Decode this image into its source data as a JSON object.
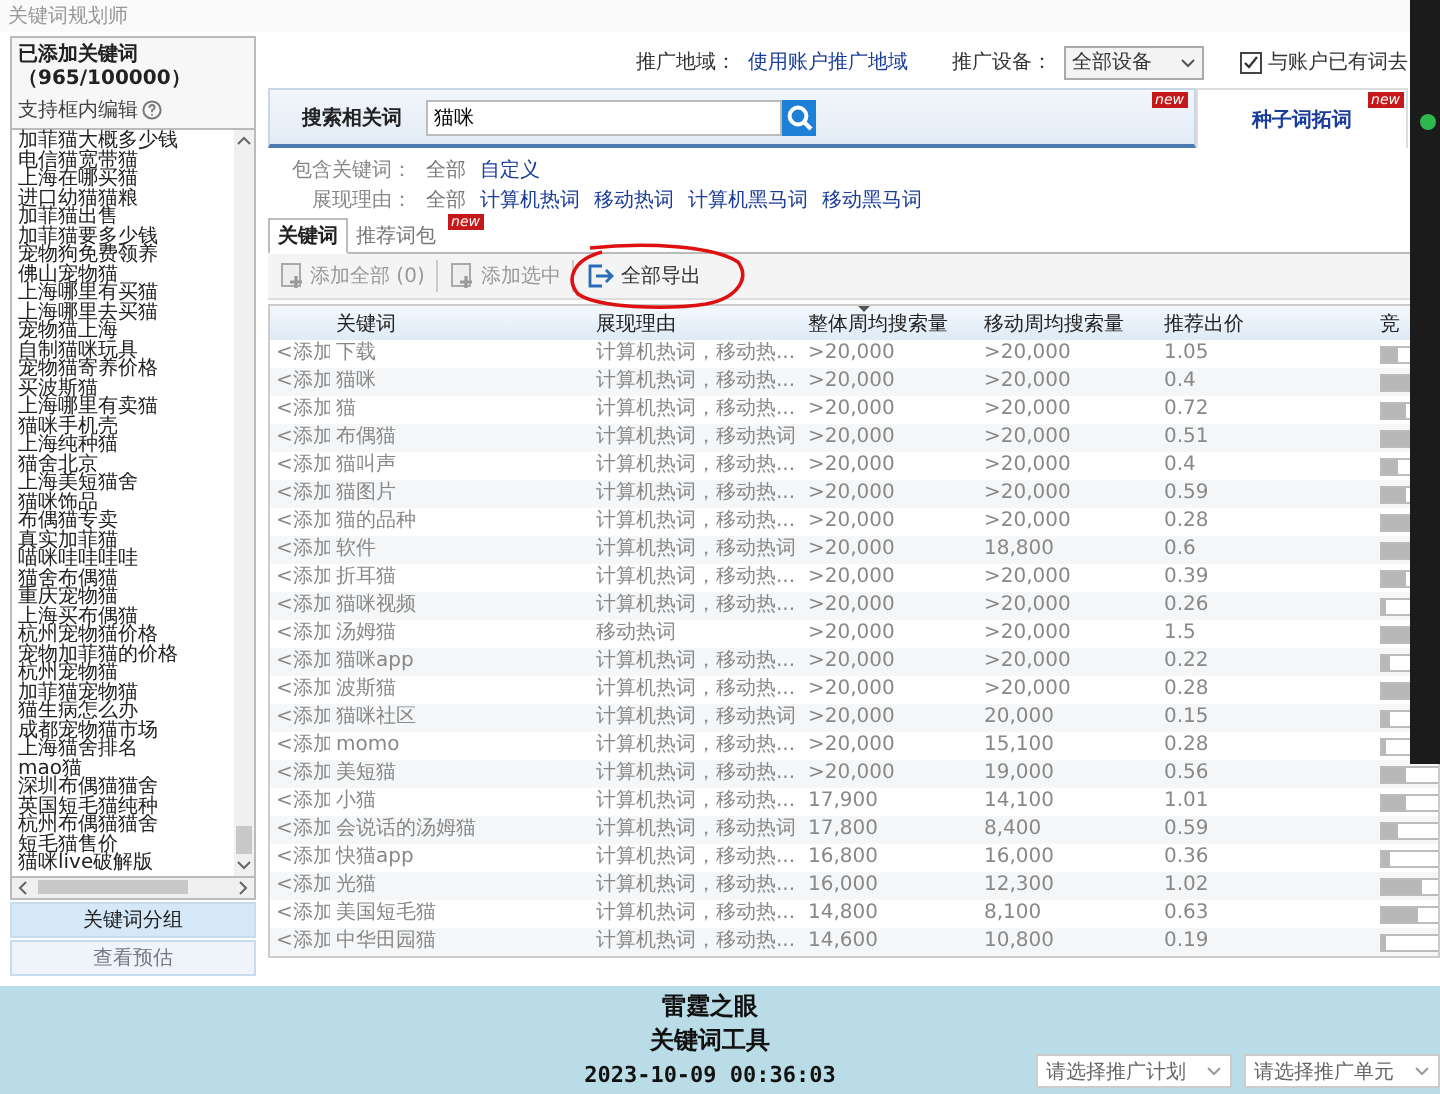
{
  "window": {
    "title": "关键词规划师"
  },
  "added_keywords": {
    "title": "已添加关键词（965/100000）",
    "hint": "支持框内编辑",
    "items": [
      "加菲猫大概多少钱",
      "电信猫宽带猫",
      "上海在哪买猫",
      "进口幼猫猫粮",
      "加菲猫出售",
      "加菲猫要多少钱",
      "宠物狗免费领养",
      "佛山宠物猫",
      "上海哪里有买猫",
      "上海哪里去买猫",
      "宠物猫上海",
      "自制猫咪玩具",
      "宠物猫寄养价格",
      "买波斯猫",
      "上海哪里有卖猫",
      "猫咪手机壳",
      "上海纯种猫",
      "猫舍北京",
      "上海美短猫舍",
      "猫咪饰品",
      "布偶猫专卖",
      "真实加菲猫",
      "喵咪哇哇哇哇",
      "猫舍布偶猫",
      "重庆宠物猫",
      "上海买布偶猫",
      "杭州宠物猫价格",
      "宠物加菲猫的价格",
      "杭州宠物猫",
      "加菲猫宠物猫",
      "猫生病怎么办",
      "成都宠物猫市场",
      "上海猫舍排名",
      "mao猫",
      "深圳布偶猫猫舍",
      "英国短毛猫纯种",
      "杭州布偶猫猫舍",
      "短毛猫售价",
      "猫咪live破解版"
    ]
  },
  "left_buttons": [
    {
      "label": "关键词分组",
      "disabled": false
    },
    {
      "label": "查看预估",
      "disabled": true
    }
  ],
  "settings": {
    "region_label": "推广地域：",
    "region_link": "使用账户推广地域",
    "device_label": "推广设备：",
    "device_value": "全部设备",
    "dedupe": {
      "label": "与账户已有词去",
      "checked": true
    }
  },
  "search": {
    "label": "搜索相关词",
    "value": "猫咪",
    "badge": "new"
  },
  "seed_tab": {
    "label": "种子词拓词",
    "badge": "new"
  },
  "filters": [
    {
      "label": "包含关键词：",
      "options": [
        {
          "label": "全部",
          "selected": true
        },
        {
          "label": "自定义",
          "selected": false
        }
      ]
    },
    {
      "label": "展现理由：",
      "options": [
        {
          "label": "全部",
          "selected": true
        },
        {
          "label": "计算机热词",
          "selected": false
        },
        {
          "label": "移动热词",
          "selected": false
        },
        {
          "label": "计算机黑马词",
          "selected": false
        },
        {
          "label": "移动黑马词",
          "selected": false
        }
      ]
    }
  ],
  "tabs": [
    {
      "label": "关键词",
      "selected": true
    },
    {
      "label": "推荐词包",
      "selected": false,
      "badge": "new"
    }
  ],
  "toolbar": [
    {
      "kind": "add",
      "label": "添加全部 (0)",
      "disabled": true
    },
    {
      "kind": "add",
      "label": "添加选中",
      "disabled": true
    },
    {
      "kind": "export",
      "label": "全部导出",
      "disabled": false
    }
  ],
  "table": {
    "columns": [
      {
        "label": "关键词",
        "sorted": false
      },
      {
        "label": "展现理由",
        "sorted": false
      },
      {
        "label": "整体周均搜索量",
        "sorted": true
      },
      {
        "label": "移动周均搜索量",
        "sorted": false
      },
      {
        "label": "推荐出价",
        "sorted": false
      },
      {
        "label": "竞",
        "sorted": false
      }
    ],
    "rows": [
      {
        "action": "<添加",
        "keyword": "下载",
        "reason": "计算机热词，移动热...",
        "total": ">20,000",
        "mobile": ">20,000",
        "bid": "1.05",
        "competition": {
          "level": 0.2
        }
      },
      {
        "action": "<添加",
        "keyword": "猫咪",
        "reason": "计算机热词，移动热...",
        "total": ">20,000",
        "mobile": ">20,000",
        "bid": "0.4",
        "competition": {
          "level": 0.5
        }
      },
      {
        "action": "<添加",
        "keyword": "猫",
        "reason": "计算机热词，移动热...",
        "total": ">20,000",
        "mobile": ">20,000",
        "bid": "0.72",
        "competition": {
          "level": 0.3
        }
      },
      {
        "action": "<添加",
        "keyword": "布偶猫",
        "reason": "计算机热词，移动热词",
        "total": ">20,000",
        "mobile": ">20,000",
        "bid": "0.51",
        "competition": {
          "level": 0.5
        }
      },
      {
        "action": "<添加",
        "keyword": "猫叫声",
        "reason": "计算机热词，移动热...",
        "total": ">20,000",
        "mobile": ">20,000",
        "bid": "0.4",
        "competition": {
          "level": 0.2
        }
      },
      {
        "action": "<添加",
        "keyword": "猫图片",
        "reason": "计算机热词，移动热...",
        "total": ">20,000",
        "mobile": ">20,000",
        "bid": "0.59",
        "competition": {
          "level": 0.3
        }
      },
      {
        "action": "<添加",
        "keyword": "猫的品种",
        "reason": "计算机热词，移动热...",
        "total": ">20,000",
        "mobile": ">20,000",
        "bid": "0.28",
        "competition": {
          "level": 0.4
        }
      },
      {
        "action": "<添加",
        "keyword": "软件",
        "reason": "计算机热词，移动热词",
        "total": ">20,000",
        "mobile": "18,800",
        "bid": "0.6",
        "competition": {
          "level": 0.5
        }
      },
      {
        "action": "<添加",
        "keyword": "折耳猫",
        "reason": "计算机热词，移动热...",
        "total": ">20,000",
        "mobile": ">20,000",
        "bid": "0.39",
        "competition": {
          "level": 0.3
        }
      },
      {
        "action": "<添加",
        "keyword": "猫咪视频",
        "reason": "计算机热词，移动热...",
        "total": ">20,000",
        "mobile": ">20,000",
        "bid": "0.26",
        "competition": {
          "level": 0.05
        }
      },
      {
        "action": "<添加",
        "keyword": "汤姆猫",
        "reason": "移动热词",
        "total": ">20,000",
        "mobile": ">20,000",
        "bid": "1.5",
        "competition": {
          "level": 0.5
        }
      },
      {
        "action": "<添加",
        "keyword": "猫咪app",
        "reason": "计算机热词，移动热...",
        "total": ">20,000",
        "mobile": ">20,000",
        "bid": "0.22",
        "competition": {
          "level": 0.1
        }
      },
      {
        "action": "<添加",
        "keyword": "波斯猫",
        "reason": "计算机热词，移动热...",
        "total": ">20,000",
        "mobile": ">20,000",
        "bid": "0.28",
        "competition": {
          "level": 0.4
        }
      },
      {
        "action": "<添加",
        "keyword": "猫咪社区",
        "reason": "计算机热词，移动热词",
        "total": ">20,000",
        "mobile": "20,000",
        "bid": "0.15",
        "competition": {
          "level": 0.1
        }
      },
      {
        "action": "<添加",
        "keyword": "momo",
        "reason": "计算机热词，移动热...",
        "total": ">20,000",
        "mobile": "15,100",
        "bid": "0.28",
        "competition": {
          "level": 0.05
        }
      },
      {
        "action": "<添加",
        "keyword": "美短猫",
        "reason": "计算机热词，移动热...",
        "total": ">20,000",
        "mobile": "19,000",
        "bid": "0.56",
        "competition": {
          "level": 0.3
        }
      },
      {
        "action": "<添加",
        "keyword": "小猫",
        "reason": "计算机热词，移动热...",
        "total": "17,900",
        "mobile": "14,100",
        "bid": "1.01",
        "competition": {
          "level": 0.3
        }
      },
      {
        "action": "<添加",
        "keyword": "会说话的汤姆猫",
        "reason": "计算机热词，移动热词",
        "total": "17,800",
        "mobile": "8,400",
        "bid": "0.59",
        "competition": {
          "level": 0.2
        }
      },
      {
        "action": "<添加",
        "keyword": "快猫app",
        "reason": "计算机热词，移动热...",
        "total": "16,800",
        "mobile": "16,000",
        "bid": "0.36",
        "competition": {
          "level": 0.1
        }
      },
      {
        "action": "<添加",
        "keyword": "光猫",
        "reason": "计算机热词，移动热...",
        "total": "16,000",
        "mobile": "12,300",
        "bid": "1.02",
        "competition": {
          "level": 0.5
        }
      },
      {
        "action": "<添加",
        "keyword": "美国短毛猫",
        "reason": "计算机热词，移动热...",
        "total": "14,800",
        "mobile": "8,100",
        "bid": "0.63",
        "competition": {
          "level": 0.45
        }
      },
      {
        "action": "<添加",
        "keyword": "中华田园猫",
        "reason": "计算机热词，移动热...",
        "total": "14,600",
        "mobile": "10,800",
        "bid": "0.19",
        "competition": {
          "level": 0.05
        }
      }
    ]
  },
  "plan_selects": [
    {
      "label": "请选择推广计划"
    },
    {
      "label": "请选择推广单元"
    }
  ],
  "caption": [
    "雷霆之眼",
    "关键词工具",
    "2023-10-09 00:36:03"
  ]
}
